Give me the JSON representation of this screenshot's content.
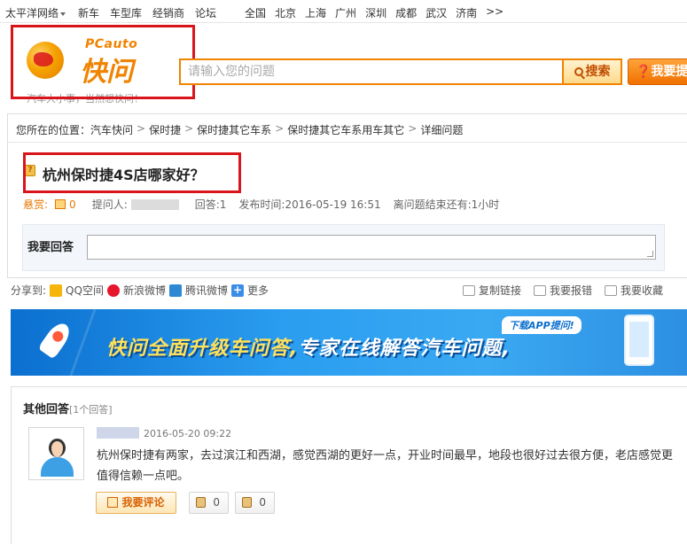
{
  "topnav": {
    "site": "太平洋网络",
    "links": [
      "新车",
      "车型库",
      "经销商",
      "论坛"
    ],
    "cities": [
      "全国",
      "北京",
      "上海",
      "广州",
      "深圳",
      "成都",
      "武汉",
      "济南",
      ">>"
    ]
  },
  "header": {
    "logo_sub": "PCauto",
    "logo_main": "快问",
    "slogan": "汽车大小事，当然想快问！",
    "search_placeholder": "请输入您的问题",
    "search_button": "搜索",
    "ask_button": "我要提问"
  },
  "breadcrumb": {
    "prefix": "您所在的位置：",
    "items": [
      "汽车快问",
      "保时捷",
      "保时捷其它车系",
      "保时捷其它车系用车其它",
      "详细问题"
    ],
    "sep": ">"
  },
  "question": {
    "title": "杭州保时捷4S店哪家好？",
    "reward_label": "悬赏:",
    "reward_value": "0",
    "asker_label": "提问人:",
    "answers_label": "回答:",
    "answers_value": "1",
    "published_label": "发布时间:",
    "published_value": "2016-05-19 16:51",
    "remaining_label": "离问题结束还有:",
    "remaining_value": "1小时"
  },
  "answer_form": {
    "label": "我要回答"
  },
  "share": {
    "label": "分享到:",
    "qq": "QQ空间",
    "sina": "新浪微博",
    "tencent": "腾讯微博",
    "more": "更多",
    "copy": "复制链接",
    "report": "我要报错",
    "collect": "我要收藏"
  },
  "banner": {
    "download": "下载APP提问!",
    "headline_part1": "快问全面升级车问答,",
    "headline_part2": "专家在线解答汽车问题,"
  },
  "answers": {
    "title": "其他回答",
    "count": "[1个回答]",
    "items": [
      {
        "time": "2016-05-20 09:22",
        "text": "杭州保时捷有两家，去过滨江和西湖，感觉西湖的更好一点，开业时间最早，地段也很好过去很方便，老店感觉更值得信赖一点吧。",
        "comment_label": "我要评论",
        "up": "0",
        "down": "0"
      }
    ]
  },
  "colors": {
    "accent": "#f08300",
    "highlight_box": "#d9151b",
    "banner_blue": "#2a9df0"
  }
}
